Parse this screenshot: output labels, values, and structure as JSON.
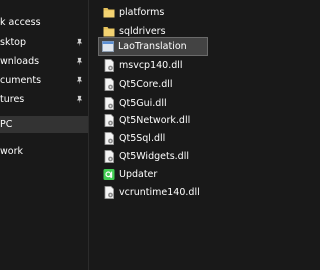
{
  "colors": {
    "background": "#191919",
    "selected_nav": "#333333",
    "selected_row": "#434343",
    "folder": "#e8c35c",
    "text": "#ffffff"
  },
  "navigation": {
    "items": [
      {
        "label": "k access",
        "pinned": false
      },
      {
        "label": "sktop",
        "pinned": true
      },
      {
        "label": "wnloads",
        "pinned": true
      },
      {
        "label": "cuments",
        "pinned": true
      },
      {
        "label": "tures",
        "pinned": true
      },
      {
        "label": "PC",
        "selected": true
      },
      {
        "label": "work"
      }
    ]
  },
  "files": [
    {
      "name": "platforms",
      "icon": "folder-icon"
    },
    {
      "name": "sqldrivers",
      "icon": "folder-icon"
    },
    {
      "name": "LaoTranslation",
      "icon": "app-icon",
      "selected": true
    },
    {
      "name": "msvcp140.dll",
      "icon": "dll-file-icon"
    },
    {
      "name": "Qt5Core.dll",
      "icon": "dll-file-icon"
    },
    {
      "name": "Qt5Gui.dll",
      "icon": "dll-file-icon"
    },
    {
      "name": "Qt5Network.dll",
      "icon": "dll-file-icon"
    },
    {
      "name": "Qt5Sql.dll",
      "icon": "dll-file-icon"
    },
    {
      "name": "Qt5Widgets.dll",
      "icon": "dll-file-icon"
    },
    {
      "name": "Updater",
      "icon": "qt-app-icon"
    },
    {
      "name": "vcruntime140.dll",
      "icon": "dll-file-icon"
    }
  ]
}
